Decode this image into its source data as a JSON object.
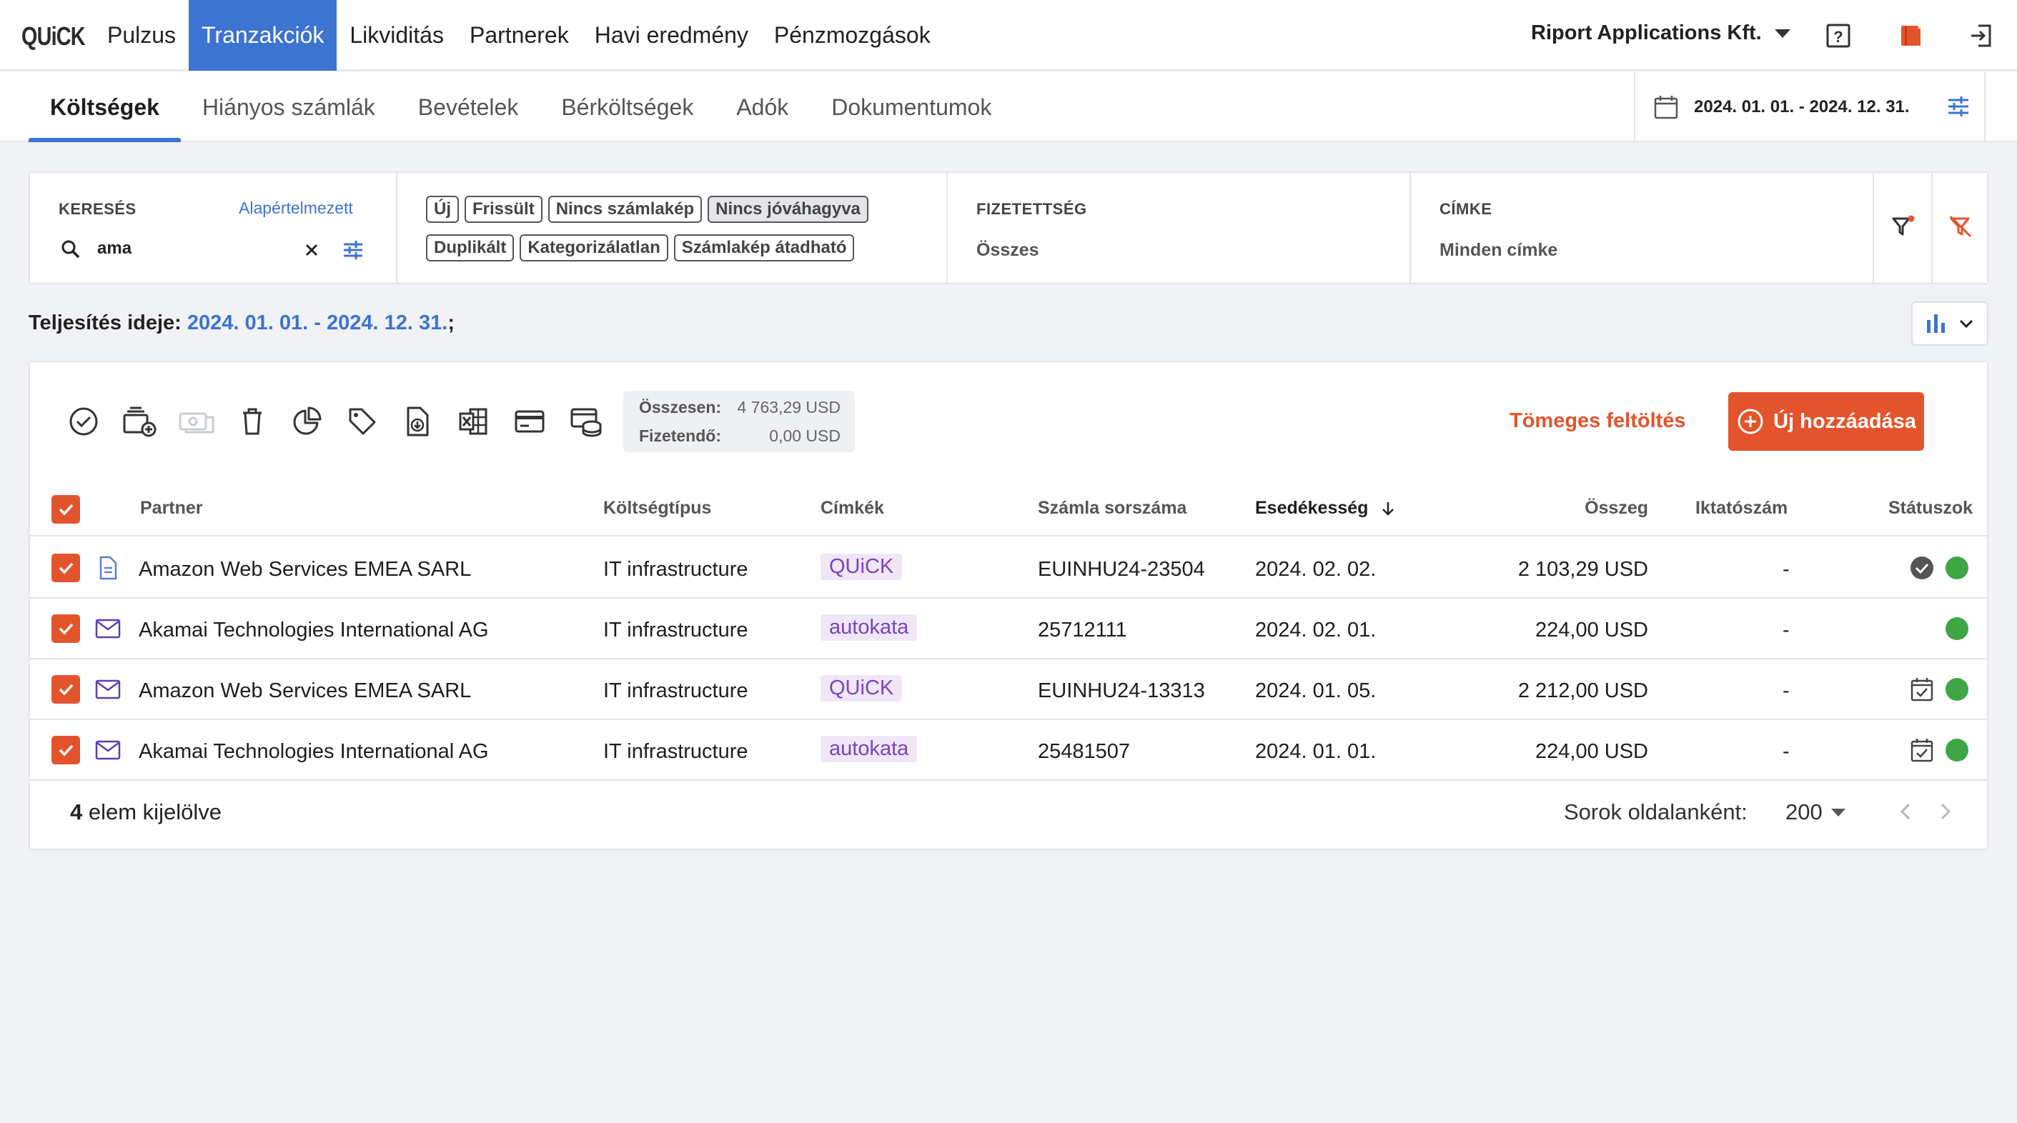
{
  "app": {
    "logo": "QUiCK"
  },
  "nav": {
    "items": [
      {
        "label": "Pulzus"
      },
      {
        "label": "Tranzakciók",
        "active": true
      },
      {
        "label": "Likviditás"
      },
      {
        "label": "Partnerek"
      },
      {
        "label": "Havi eredmény"
      },
      {
        "label": "Pénzmozgások"
      }
    ],
    "company": "Riport Applications Kft."
  },
  "subnav": {
    "tabs": [
      {
        "label": "Költségek",
        "active": true
      },
      {
        "label": "Hiányos számlák"
      },
      {
        "label": "Bevételek"
      },
      {
        "label": "Bérköltségek"
      },
      {
        "label": "Adók"
      },
      {
        "label": "Dokumentumok"
      }
    ],
    "daterange": "2024. 01. 01. - 2024. 12. 31."
  },
  "filters": {
    "search_label": "KERESÉS",
    "default_link": "Alapértelmezett",
    "search_value": "ama",
    "chips_row1": [
      {
        "label": "Új",
        "selected": false
      },
      {
        "label": "Frissült",
        "selected": false
      },
      {
        "label": "Nincs számlakép",
        "selected": false
      },
      {
        "label": "Nincs jóváhagyva",
        "selected": true
      }
    ],
    "chips_row2": [
      {
        "label": "Duplikált",
        "selected": false
      },
      {
        "label": "Kategorizálatlan",
        "selected": false
      },
      {
        "label": "Számlakép átadható",
        "selected": false
      }
    ],
    "payment_label": "FIZETETTSÉG",
    "payment_value": "Összes",
    "tag_label": "CÍMKE",
    "tag_value": "Minden címke"
  },
  "dateinfo": {
    "label": "Teljesítés ideje:",
    "value": "2024. 01. 01. - 2024. 12. 31.",
    "suffix": ";"
  },
  "summary": {
    "total_label": "Összesen:",
    "total_value": "4 763,29 USD",
    "due_label": "Fizetendő:",
    "due_value": "0,00 USD"
  },
  "actions": {
    "bulk_upload": "Tömeges feltöltés",
    "add_new": "Új hozzáadása"
  },
  "table": {
    "headers": {
      "partner": "Partner",
      "cost_type": "Költségtípus",
      "tags": "Címkék",
      "invoice_no": "Számla sorszáma",
      "due": "Esedékesség",
      "amount": "Összeg",
      "filing_no": "Iktatószám",
      "statuses": "Státuszok"
    },
    "rows": [
      {
        "source_icon": "document-icon",
        "partner": "Amazon Web Services EMEA SARL",
        "cost_type": "IT infrastructure",
        "tag": "QUiCK",
        "invoice_no": "EUINHU24-23504",
        "due": "2024. 02. 02.",
        "amount": "2 103,29 USD",
        "filing_no": "-",
        "status_icon": "check-circle-icon"
      },
      {
        "source_icon": "envelope-icon",
        "partner": "Akamai Technologies International AG",
        "cost_type": "IT infrastructure",
        "tag": "autokata",
        "invoice_no": "25712111",
        "due": "2024. 02. 01.",
        "amount": "224,00 USD",
        "filing_no": "-",
        "status_icon": ""
      },
      {
        "source_icon": "envelope-icon",
        "partner": "Amazon Web Services EMEA SARL",
        "cost_type": "IT infrastructure",
        "tag": "QUiCK",
        "invoice_no": "EUINHU24-13313",
        "due": "2024. 01. 05.",
        "amount": "2 212,00 USD",
        "filing_no": "-",
        "status_icon": "calendar-check-icon"
      },
      {
        "source_icon": "envelope-icon",
        "partner": "Akamai Technologies International AG",
        "cost_type": "IT infrastructure",
        "tag": "autokata",
        "invoice_no": "25481507",
        "due": "2024. 01. 01.",
        "amount": "224,00 USD",
        "filing_no": "-",
        "status_icon": "calendar-check-icon"
      }
    ]
  },
  "footer": {
    "selected_count": "4",
    "selected_label": "elem kijelölve",
    "rows_per_page_label": "Sorok oldalanként:",
    "rows_per_page_value": "200"
  },
  "colors": {
    "accent_blue": "#3d73d1",
    "accent_orange": "#e4542c",
    "status_green": "#3fa646",
    "tag_purple": "#7a43c2"
  }
}
